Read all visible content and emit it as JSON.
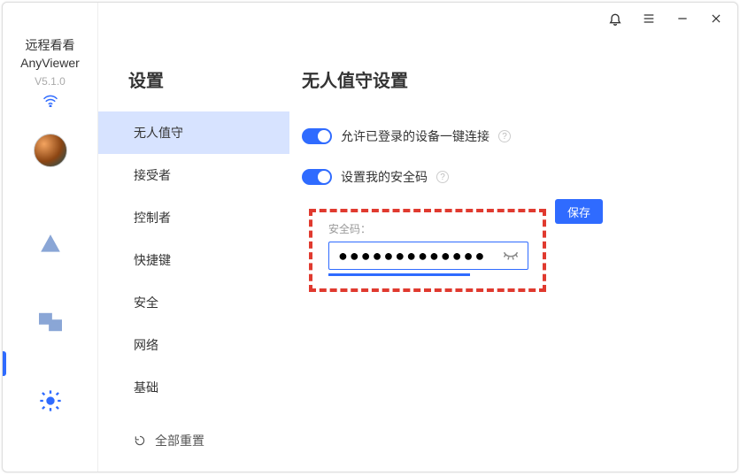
{
  "brand": {
    "line1": "远程看看",
    "line2": "AnyViewer",
    "version": "V5.1.0"
  },
  "titlebar": {},
  "rail": {},
  "subnav": {
    "title": "设置",
    "items": [
      "无人值守",
      "接受者",
      "控制者",
      "快捷键",
      "安全",
      "网络",
      "基础"
    ],
    "selected": 0,
    "reset": "全部重置"
  },
  "content": {
    "title": "无人值守设置",
    "toggles": [
      {
        "label": "允许已登录的设备一键连接",
        "on": true
      },
      {
        "label": "设置我的安全码",
        "on": true
      }
    ],
    "security": {
      "label": "安全码：",
      "value": "●●●●●●●●●●●●●",
      "save": "保存"
    }
  }
}
